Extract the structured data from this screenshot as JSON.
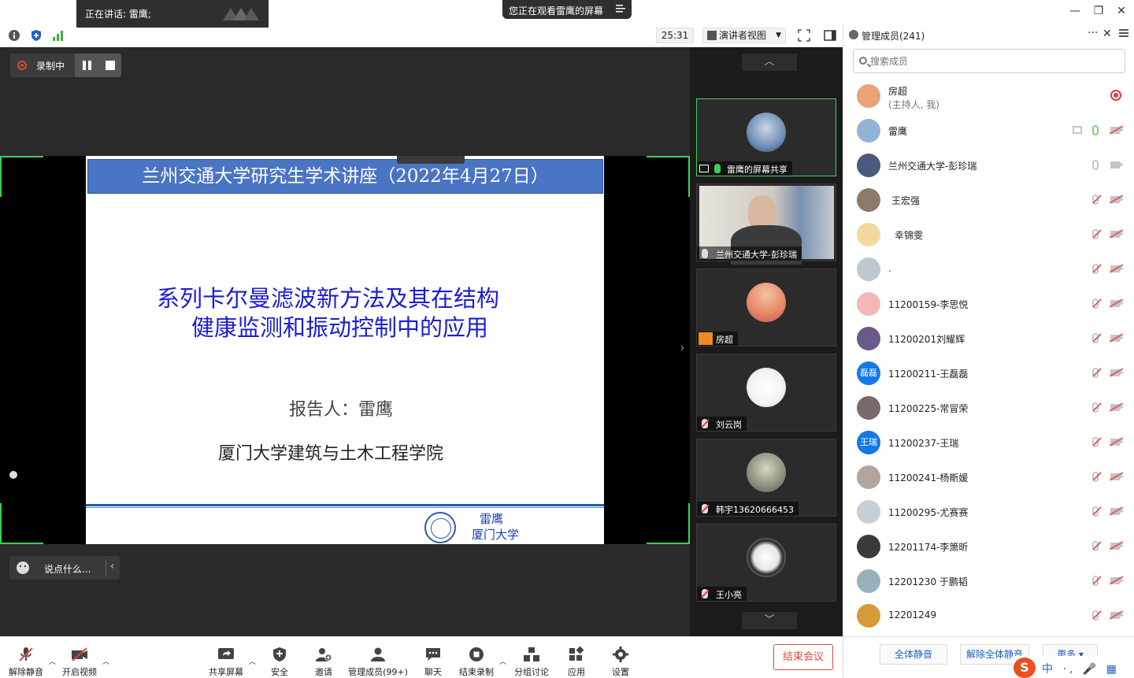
{
  "titlebar": {
    "speaking": "正在讲话: 雷鹰;",
    "watching": "您正在观看雷鹰的屏幕"
  },
  "toolbar": {
    "timer": "25:31",
    "view_mode": "演讲者视图"
  },
  "recording": {
    "label": "录制中"
  },
  "slide": {
    "header": "兰州交通大学研究生学术讲座（2022年4月27日）",
    "title_line1": "系列卡尔曼滤波新方法及其在结构",
    "title_line2": "健康监测和振动控制中的应用",
    "reporter": "报告人：雷鹰",
    "school": "厦门大学建筑与土木工程学院",
    "footer_name": "雷鹰",
    "footer_school": "厦门大学"
  },
  "chat": {
    "placeholder": "说点什么..."
  },
  "gallery": {
    "tiles": [
      {
        "label": "雷鹰的屏幕共享"
      },
      {
        "label": "兰州交通大学-彭珍瑞"
      },
      {
        "label": "房超"
      },
      {
        "label": "刘云岗"
      },
      {
        "label": "韩宇13620666453"
      },
      {
        "label": "王小亮"
      }
    ]
  },
  "panel": {
    "title": "管理成员(241)",
    "search_placeholder": "搜索成员",
    "members": [
      {
        "name": "房超",
        "sub": "(主持人, 我)",
        "color": "#e9a27a"
      },
      {
        "name": "雷鹰",
        "color": "#8fb4d6"
      },
      {
        "name": "兰州交通大学-彭珍瑞",
        "color": "#4a5a7a"
      },
      {
        "name": "王宏强",
        "color": "#8a7a6a"
      },
      {
        "name": "幸锦雯",
        "color": "#f1d9a0"
      },
      {
        "name": ".",
        "color": "#bfc7cf"
      },
      {
        "name": "11200159-李思悦",
        "color": "#f3b7b7"
      },
      {
        "name": "11200201刘耀辉",
        "color": "#6a5a8a"
      },
      {
        "name": "11200211-王磊磊",
        "initials": "磊磊",
        "color": "#1677e6"
      },
      {
        "name": "11200225-常冒荣",
        "color": "#7a6a6a"
      },
      {
        "name": "11200237-王瑞",
        "initials": "王瑞",
        "color": "#1677e6"
      },
      {
        "name": "11200241-杨斯媛",
        "color": "#b3a59b"
      },
      {
        "name": "11200295-尤赛赛",
        "color": "#c7ced6"
      },
      {
        "name": "12201174-李箫昕",
        "color": "#3a3a3a"
      },
      {
        "name": "12201230 于鹏韬",
        "color": "#9ab0bc"
      },
      {
        "name": "12201249",
        "color": "#d69a3a"
      }
    ],
    "mute_all": "全体静音",
    "unmute_all": "解除全体静音",
    "more": "更多",
    "ime_text": "中 ·, 🎤 ▦"
  },
  "bottombar": {
    "unmute": "解除静音",
    "start_video": "开启视频",
    "share_screen": "共享屏幕",
    "security": "安全",
    "invite": "邀请",
    "manage_members": "管理成员(99+)",
    "chat": "聊天",
    "end_recording": "结束录制",
    "breakout": "分组讨论",
    "apps": "应用",
    "settings": "设置",
    "end_meeting": "结束会议"
  },
  "colors": {
    "accent_green": "#3ccf5a",
    "danger": "#e0463f",
    "link_blue": "#1f62c6",
    "slide_blue": "#4a74c4"
  }
}
